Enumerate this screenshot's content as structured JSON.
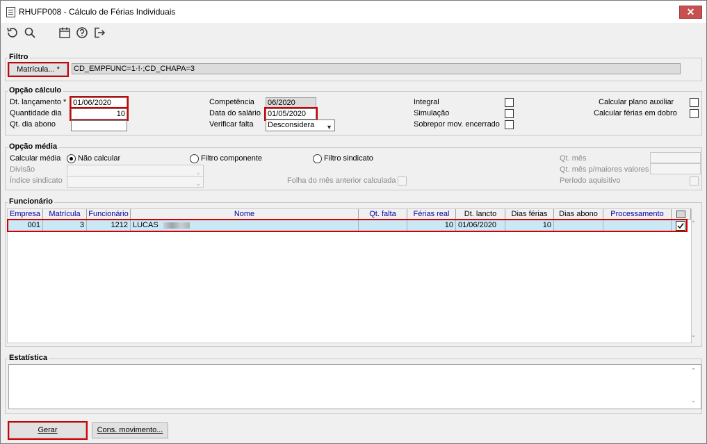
{
  "window": {
    "title": "RHUFP008 - Cálculo de Férias Individuais",
    "close": "✕"
  },
  "filtro": {
    "group_label": "Filtro",
    "matricula_button": "Matrícula... *",
    "value": "CD_EMPFUNC=1·!·;CD_CHAPA=3"
  },
  "opcao_calculo": {
    "group_label": "Opção cálculo",
    "dt_lancamento_label": "Dt. lançamento *",
    "dt_lancamento_value": "01/06/2020",
    "quantidade_dia_label": "Quantidade dia",
    "quantidade_dia_value": "10",
    "qt_dia_abono_label": "Qt. dia abono",
    "qt_dia_abono_value": "",
    "competencia_label": "Competência",
    "competencia_value": "06/2020",
    "data_salario_label": "Data do salário",
    "data_salario_value": "01/05/2020",
    "verificar_falta_label": "Verificar falta",
    "verificar_falta_value": "Desconsidera",
    "integral_label": "Integral",
    "simulacao_label": "Simulação",
    "sobrepor_label": "Sobrepor mov. encerrado",
    "plano_auxiliar_label": "Calcular plano auxiliar",
    "ferias_dobro_label": "Calcular férias em dobro"
  },
  "opcao_media": {
    "group_label": "Opção média",
    "calcular_media_label": "Calcular média",
    "radio_nao_calcular": "Não calcular",
    "radio_filtro_componente": "Filtro componente",
    "radio_filtro_sindicato": "Filtro sindicato",
    "divisao_label": "Divisão",
    "indice_sindicato_label": "Índice sindicato",
    "folha_mes_anterior_label": "Folha do mês anterior calculada",
    "qt_mes_label": "Qt. mês",
    "qt_mes_maiores_label": "Qt. mês p/maiores valores",
    "periodo_aquisitivo_label": "Período aquisitivo"
  },
  "funcionario": {
    "group_label": "Funcionário",
    "columns": [
      "Empresa",
      "Matrícula",
      "Funcionário",
      "Nome",
      "Qt. falta",
      "Férias real",
      "Dt. lancto",
      "Dias férias",
      "Dias abono",
      "Processamento"
    ],
    "rows": [
      {
        "empresa": "001",
        "matricula": "3",
        "funcionario": "1212",
        "nome": "LUCAS",
        "qt_falta": "",
        "ferias_real": "10",
        "dt_lancto": "01/06/2020",
        "dias_ferias": "10",
        "dias_abono": "",
        "processamento": "",
        "checked": true
      }
    ]
  },
  "estatistica": {
    "group_label": "Estatística"
  },
  "buttons": {
    "gerar": "Gerar",
    "cons_movimento": "Cons. movimento..."
  },
  "icons": {
    "undo": "undo-icon",
    "search": "search-icon",
    "calendar": "calendar-icon",
    "help": "help-icon",
    "exit": "exit-icon"
  }
}
